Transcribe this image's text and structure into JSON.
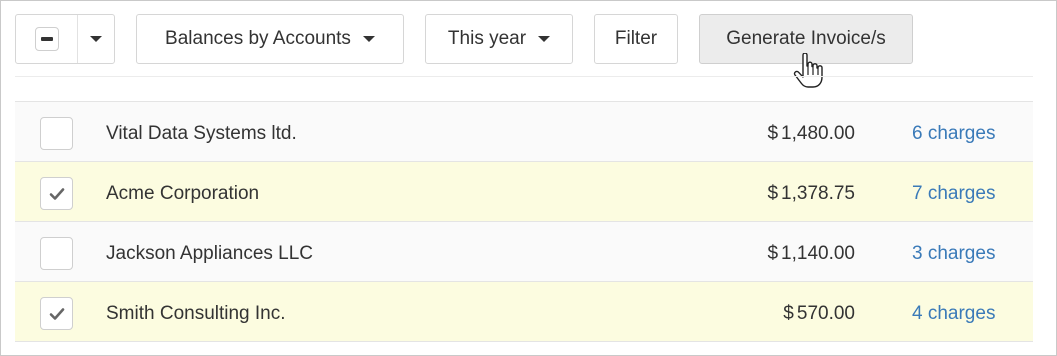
{
  "toolbar": {
    "select_all": {
      "state": "indeterminate",
      "icon": "minus-icon",
      "dropdown_icon": "caret-down-icon"
    },
    "balances_label": "Balances by Accounts",
    "period_label": "This year",
    "filter_label": "Filter",
    "generate_label": "Generate Invoice/s"
  },
  "accounts": [
    {
      "name": "Vital Data Systems ltd.",
      "currency": "$",
      "amount": "1,480.00",
      "charges": "6 charges",
      "checked": false
    },
    {
      "name": "Acme Corporation",
      "currency": "$",
      "amount": "1,378.75",
      "charges": "7 charges",
      "checked": true
    },
    {
      "name": "Jackson Appliances LLC",
      "currency": "$",
      "amount": "1,140.00",
      "charges": "3 charges",
      "checked": false
    },
    {
      "name": "Smith Consulting Inc.",
      "currency": "$",
      "amount": "570.00",
      "charges": "4 charges",
      "checked": true
    }
  ],
  "colors": {
    "selected_row": "#fcfce0",
    "link": "#3a7ab8",
    "generate_button": "#ececec"
  }
}
